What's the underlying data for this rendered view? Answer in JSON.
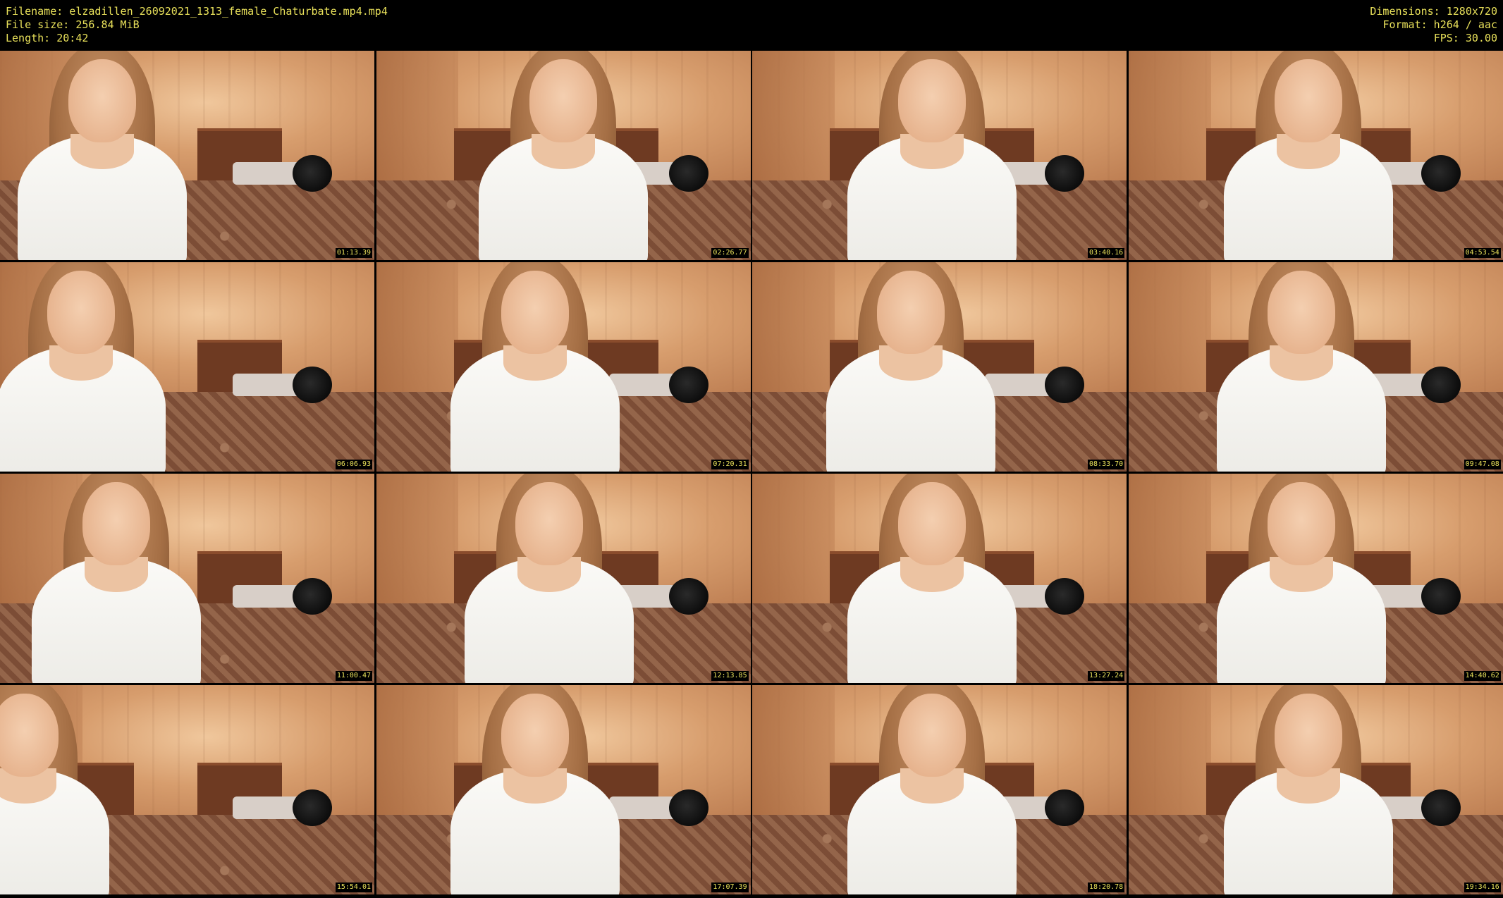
{
  "header": {
    "filename": "Filename: elzadillen_26092021_1313_female_Chaturbate.mp4.mp4",
    "filesize": "File size: 256.84 MiB",
    "length": "Length: 20:42",
    "dimensions": "Dimensions: 1280x720",
    "format": "Format: h264 / aac",
    "fps": "FPS: 30.00"
  },
  "thumbnails": [
    {
      "timestamp": "01:13.39"
    },
    {
      "timestamp": "02:26.77"
    },
    {
      "timestamp": "03:40.16"
    },
    {
      "timestamp": "04:53.54"
    },
    {
      "timestamp": "06:06.93"
    },
    {
      "timestamp": "07:20.31"
    },
    {
      "timestamp": "08:33.70"
    },
    {
      "timestamp": "09:47.08"
    },
    {
      "timestamp": "11:00.47"
    },
    {
      "timestamp": "12:13.85"
    },
    {
      "timestamp": "13:27.24"
    },
    {
      "timestamp": "14:40.62"
    },
    {
      "timestamp": "15:54.01"
    },
    {
      "timestamp": "17:07.39"
    },
    {
      "timestamp": "18:20.78"
    },
    {
      "timestamp": "19:34.16"
    }
  ],
  "colors": {
    "metadata_text": "#e8e05a",
    "background": "#000000"
  }
}
